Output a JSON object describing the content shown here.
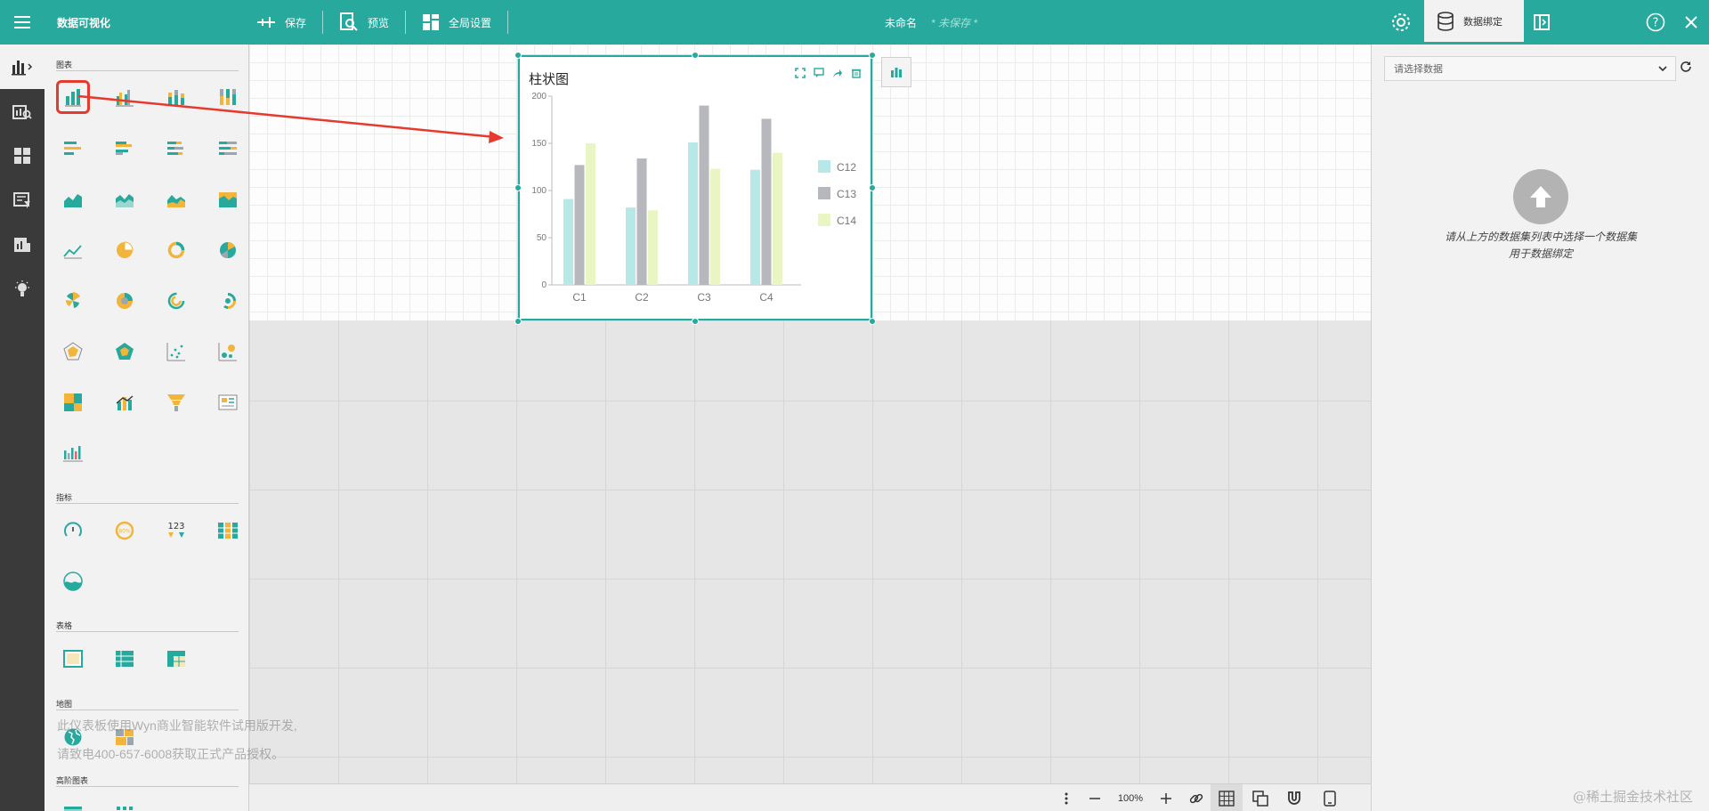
{
  "topbar": {
    "app_title": "数据可视化",
    "save_label": "保存",
    "preview_label": "预览",
    "global_settings_label": "全局设置",
    "doc_name": "未命名",
    "unsaved_label": "* 未保存 *",
    "data_binding_label": "数据绑定"
  },
  "palette": {
    "sections": {
      "charts": "图表",
      "indicators": "指标",
      "tables": "表格",
      "maps": "地图",
      "advanced": "高阶图表"
    }
  },
  "widget": {
    "title": "柱状图"
  },
  "chart_data": {
    "type": "bar",
    "title": "柱状图",
    "categories": [
      "C1",
      "C2",
      "C3",
      "C4"
    ],
    "series": [
      {
        "name": "C12",
        "values": [
          91,
          82,
          151,
          122
        ],
        "color": "#b6e8e8"
      },
      {
        "name": "C13",
        "values": [
          127,
          134,
          190,
          176
        ],
        "color": "#b6b8bd"
      },
      {
        "name": "C14",
        "values": [
          150,
          79,
          123,
          140
        ],
        "color": "#eaf5c4"
      }
    ],
    "yticks": [
      0,
      50,
      100,
      150,
      200
    ],
    "ylim": [
      0,
      200
    ],
    "legend": "right",
    "grid": false
  },
  "right_panel": {
    "select_placeholder": "请选择数据",
    "hint": "请从上方的数据集列表中选择一个数据集用于数据绑定"
  },
  "bottombar": {
    "zoom": "100%"
  },
  "watermark": {
    "line1": "此仪表板使用Wyn商业智能软件试用版开发,",
    "line2": "请致电400-657-6008获取正式产品授权。",
    "corner": "@稀土掘金技术社区"
  },
  "colors": {
    "brand": "#27a99d",
    "highlight": "#e63a2e"
  }
}
